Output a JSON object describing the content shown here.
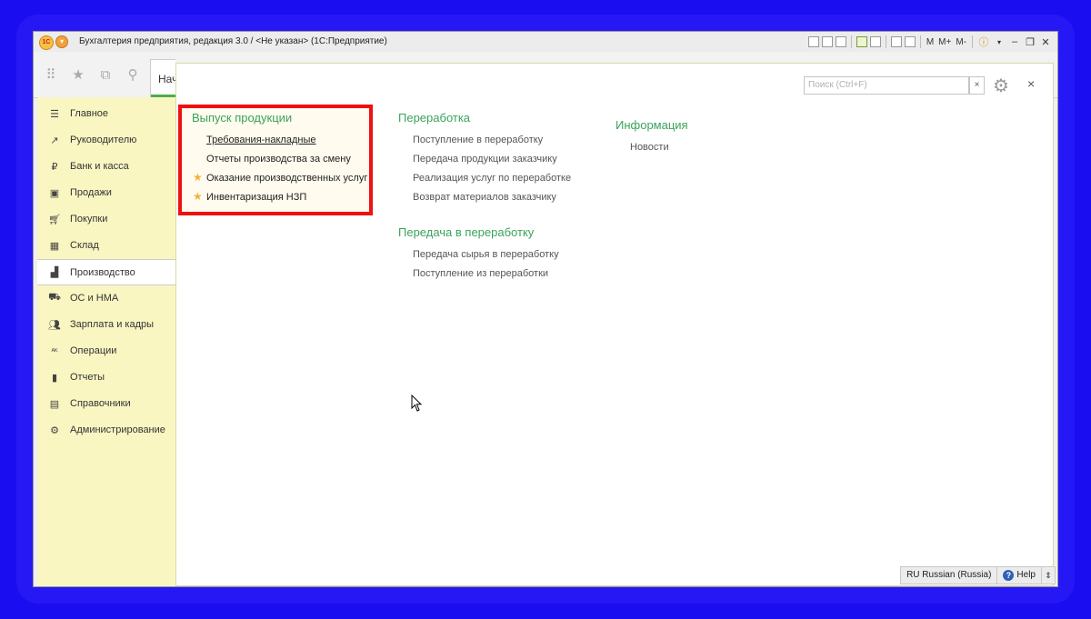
{
  "window": {
    "title": "Бухгалтерия предприятия, редакция 3.0 / <Не указан>  (1С:Предприятие)",
    "logo": "1С",
    "toolbar_m": "M",
    "toolbar_mplus": "M+",
    "toolbar_mminus": "M-"
  },
  "topbar": {
    "tab_start": "Начальная страница"
  },
  "sidebar": {
    "items": [
      {
        "label": "Главное",
        "icon": "menu-icon"
      },
      {
        "label": "Руководителю",
        "icon": "trend-icon"
      },
      {
        "label": "Банк и касса",
        "icon": "ruble-icon"
      },
      {
        "label": "Продажи",
        "icon": "bag-icon"
      },
      {
        "label": "Покупки",
        "icon": "cart-icon"
      },
      {
        "label": "Склад",
        "icon": "grid-icon"
      },
      {
        "label": "Производство",
        "icon": "factory-icon"
      },
      {
        "label": "ОС и НМА",
        "icon": "truck-icon"
      },
      {
        "label": "Зарплата и кадры",
        "icon": "people-icon"
      },
      {
        "label": "Операции",
        "icon": "ops-icon"
      },
      {
        "label": "Отчеты",
        "icon": "barchart-icon"
      },
      {
        "label": "Справочники",
        "icon": "book-icon"
      },
      {
        "label": "Администрирование",
        "icon": "gear-icon"
      }
    ]
  },
  "search": {
    "placeholder": "Поиск (Ctrl+F)",
    "clear": "×"
  },
  "sections": {
    "output": {
      "title": "Выпуск продукции",
      "links": [
        "Требования-накладные",
        "Отчеты производства за смену",
        "Оказание производственных услуг",
        "Инвентаризация НЗП"
      ]
    },
    "processing": {
      "title": "Переработка",
      "links": [
        "Поступление в переработку",
        "Передача продукции заказчику",
        "Реализация услуг по переработке",
        "Возврат материалов заказчику"
      ]
    },
    "transfer": {
      "title": "Передача в переработку",
      "links": [
        "Передача сырья в переработку",
        "Поступление из переработки"
      ]
    },
    "info": {
      "title": "Информация",
      "links": [
        "Новости"
      ]
    }
  },
  "statusbar": {
    "language": "RU Russian (Russia)",
    "help": "Help"
  },
  "colors": {
    "accent_green": "#3aa35a",
    "highlight_red": "#ee1111",
    "sidebar_bg": "#faf6c2"
  }
}
